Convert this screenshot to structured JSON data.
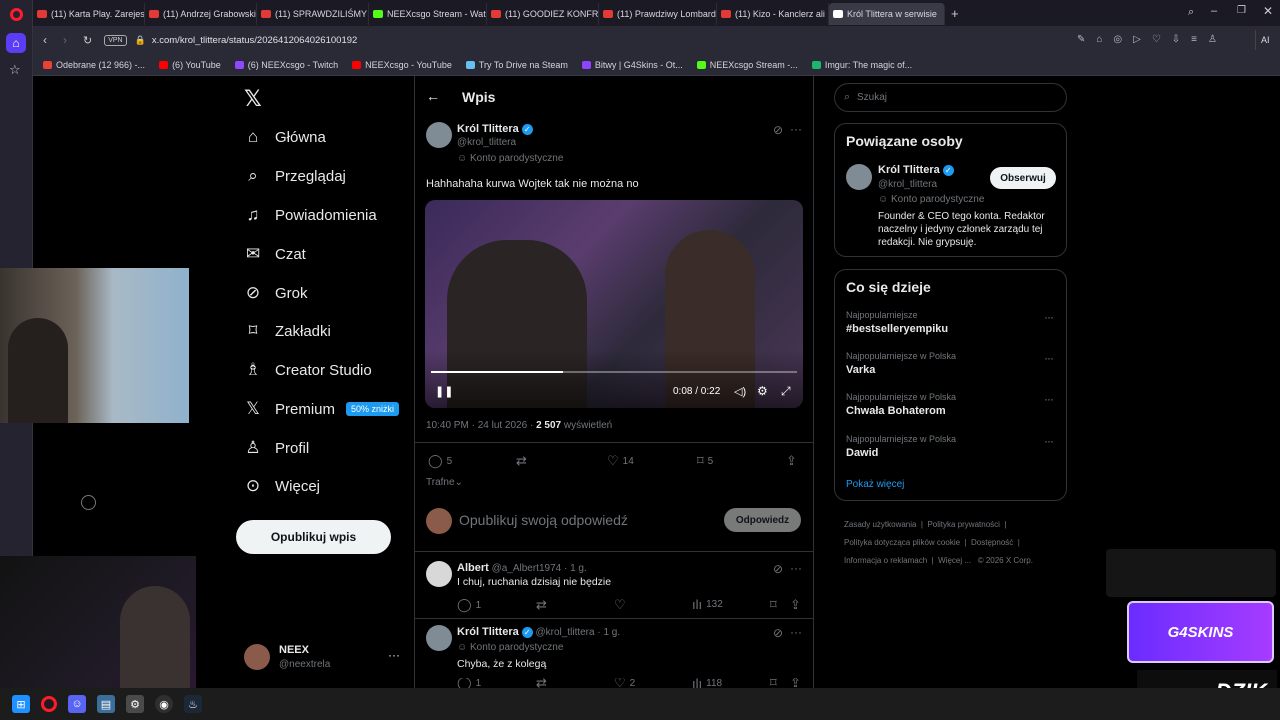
{
  "browser": {
    "tabs": [
      {
        "label": "(11) Karta Play. Zarejestruj",
        "color": "#e53935"
      },
      {
        "label": "(11) Andrzej Grabowski w",
        "color": "#e53935"
      },
      {
        "label": "(11) SPRAWDZILIŚMY NO",
        "color": "#e53935"
      },
      {
        "label": "NEEXcsgo Stream - Watch",
        "color": "#53fc18"
      },
      {
        "label": "(11) GOODIEZ KONFRONT",
        "color": "#e53935"
      },
      {
        "label": "(11) Prawdziwy Lombard",
        "color": "#e53935"
      },
      {
        "label": "(11) Kizo - Kanclerz ali",
        "color": "#e53935"
      },
      {
        "label": "Król Tlittera w serwisie",
        "color": "#ffffff"
      }
    ],
    "url": "x.com/krol_tlittera/status/2026412064026100192",
    "vpn_label": "VPN",
    "ai_label": "AI",
    "bookmarks": [
      {
        "label": "Odebrane (12 966) -...",
        "color": "#ea4335"
      },
      {
        "label": "(6) YouTube",
        "color": "#ff0000"
      },
      {
        "label": "(6) NEEXcsgo - Twitch",
        "color": "#9146ff"
      },
      {
        "label": "NEEXcsgo - YouTube",
        "color": "#ff0000"
      },
      {
        "label": "Try To Drive na Steam",
        "color": "#66c0f4"
      },
      {
        "label": "Bitwy | G4Skins - Ot...",
        "color": "#8e44ff"
      },
      {
        "label": "NEEXcsgo Stream -...",
        "color": "#53fc18"
      },
      {
        "label": "Imgur: The magic of...",
        "color": "#1bb76e"
      }
    ]
  },
  "nav": {
    "items": [
      {
        "label": "Główna",
        "icon": "home-icon"
      },
      {
        "label": "Przeglądaj",
        "icon": "search-icon"
      },
      {
        "label": "Powiadomienia",
        "icon": "bell-icon"
      },
      {
        "label": "Czat",
        "icon": "mail-icon"
      },
      {
        "label": "Grok",
        "icon": "grok-icon"
      },
      {
        "label": "Zakładki",
        "icon": "bookmark-icon"
      },
      {
        "label": "Creator Studio",
        "icon": "creator-icon"
      },
      {
        "label": "Premium",
        "icon": "x-icon"
      },
      {
        "label": "Profil",
        "icon": "person-icon"
      },
      {
        "label": "Więcej",
        "icon": "more-icon"
      }
    ],
    "premium_badge": "50% zniżki",
    "post_button": "Opublikuj wpis",
    "account": {
      "name": "NEEX",
      "handle": "@neextrela"
    }
  },
  "post": {
    "header": "Wpis",
    "author": "Król Tlittera",
    "handle": "@krol_tlittera",
    "parody": "Konto parodystyczne",
    "text": "Hahhahaha kurwa Wojtek tak nie można no",
    "video_time": "0:08 / 0:22",
    "video_progress": 0.36,
    "timestamp": "10:40 PM · 24 lut 2026 · ",
    "views": "2 507",
    "views_label": "wyświetleń",
    "replies": "5",
    "likes": "14",
    "bookmarks": "5",
    "sort_label": "Trafne",
    "reply_placeholder": "Opublikuj swoją odpowiedź",
    "reply_button": "Odpowiedz"
  },
  "replies": [
    {
      "name": "Albert",
      "handle": "@a_Albert1974 · 1 g.",
      "text": "I chuj, ruchania dzisiaj nie będzie",
      "replies": "1",
      "views": "132"
    },
    {
      "name": "Król Tlittera",
      "handle": "@krol_tlittera · 1 g.",
      "parody": "Konto parodystyczne",
      "text": "Chyba, że z kolegą",
      "replies": "1",
      "likes": "2",
      "views": "118"
    }
  ],
  "right": {
    "search_placeholder": "Szukaj",
    "related_title": "Powiązane osoby",
    "related_name": "Król Tlittera",
    "related_handle": "@krol_tlittera",
    "related_parody": "Konto parodystyczne",
    "follow_button": "Obserwuj",
    "related_bio": "Founder & CEO tego konta. Redaktor naczelny i jedyny członek zarządu tej redakcji. Nie grypsuję.",
    "trends_title": "Co się dzieje",
    "trends": [
      {
        "context": "Najpopularniejsze",
        "name": "#bestselleryempiku"
      },
      {
        "context": "Najpopularniejsze w Polska",
        "name": "Varka"
      },
      {
        "context": "Najpopularniejsze w Polska",
        "name": "Chwała Bohaterom"
      },
      {
        "context": "Najpopularniejsze w Polska",
        "name": "Dawid"
      }
    ],
    "show_more": "Pokaż więcej",
    "footer": [
      "Zasady użytkowania",
      "Polityka prywatności",
      "Polityka dotycząca plików cookie",
      "Dostępność",
      "Informacja o reklamach",
      "Więcej ...",
      "© 2026 X Corp."
    ]
  },
  "overlay": {
    "g4skins": "G4SKINS",
    "dzik": "DZIK"
  }
}
